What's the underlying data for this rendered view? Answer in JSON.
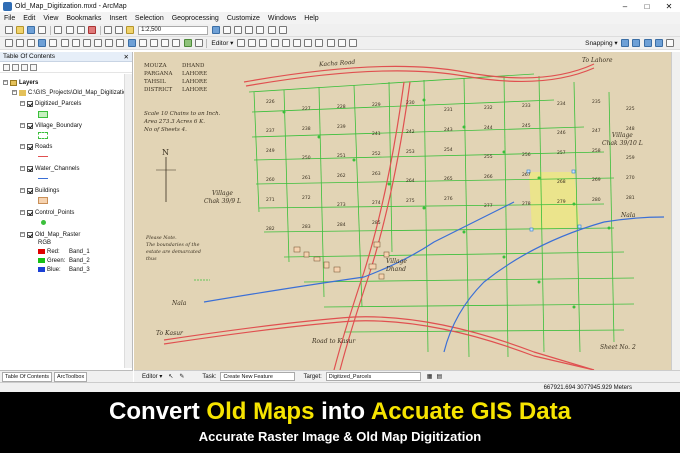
{
  "window": {
    "title": "Old_Map_Digitization.mxd - ArcMap",
    "minimize": "–",
    "maximize": "□",
    "close": "✕"
  },
  "menu": [
    "File",
    "Edit",
    "View",
    "Bookmarks",
    "Insert",
    "Selection",
    "Geoprocessing",
    "Customize",
    "Windows",
    "Help"
  ],
  "toolbar": {
    "scale": "1:2,500",
    "editor_label": "Editor ▾",
    "snapping_label": "Snapping ▾"
  },
  "toc": {
    "header": "Table Of Contents",
    "root": "Layers",
    "path": "C:\\GIS_Projects\\Old_Map_Digitization",
    "layers": [
      "Digitized_Parcels",
      "Village_Boundary",
      "Roads",
      "Water_Channels",
      "Buildings",
      "Control_Points",
      "Old_Map_Raster"
    ],
    "rgb_label": "RGB",
    "bands": [
      {
        "name": "Red:",
        "value": "Band_1",
        "color": "#e00000"
      },
      {
        "name": "Green:",
        "value": "Band_2",
        "color": "#16c016"
      },
      {
        "name": "Blue:",
        "value": "Band_3",
        "color": "#1a3fd6"
      }
    ]
  },
  "bottom_tabs": [
    "Table Of Contents",
    "ArcToolbox"
  ],
  "editor_bar": {
    "editor": "Editor ▾",
    "task_label": "Task:",
    "task_value": "Create New Feature",
    "target_label": "Target:",
    "target_value": "Digitized_Parcels"
  },
  "status": {
    "coords": "667921.694   3077945.929 Meters"
  },
  "map": {
    "info": [
      [
        "MOUZA",
        "DHAND"
      ],
      [
        "PARGANA",
        "LAHORE"
      ],
      [
        "TAHSIL",
        "LAHORE"
      ],
      [
        "DISTRICT",
        "LAHORE"
      ]
    ],
    "scale_note": [
      "Scale 10 Chains to an Inch.",
      "Area 273.3 Acres 6 K.",
      "No of Sheets 4."
    ],
    "north": "N",
    "kacha_road": "Kacha Road",
    "to_lahore": "To Lahore",
    "village_left": [
      "Village",
      "Chak 39/9 L"
    ],
    "village_right": [
      "Village",
      "Chak 39/10 L"
    ],
    "village_dhand": [
      "Village",
      "Dhand"
    ],
    "nala_right": "Nala",
    "nala_left": "Nala",
    "to_kasur": "To Kasur",
    "road_to_kasur": "Road to Kasur",
    "sheet": "Sheet No. 2",
    "note": [
      "Please Note.",
      "The boundaries of the",
      "estate are demarcated",
      "thus"
    ],
    "parcels": [
      "226",
      "227",
      "228",
      "229",
      "230",
      "231",
      "232",
      "233",
      "234",
      "235",
      "225",
      "237",
      "238",
      "239",
      "241",
      "242",
      "243",
      "244",
      "245",
      "246",
      "247",
      "248",
      "249",
      "250",
      "251",
      "252",
      "253",
      "254",
      "255",
      "256",
      "257",
      "258",
      "259",
      "260",
      "261",
      "262",
      "263",
      "264",
      "265",
      "266",
      "267",
      "268",
      "269",
      "270",
      "271",
      "272",
      "273",
      "274",
      "275",
      "276",
      "277",
      "278",
      "279",
      "280",
      "281",
      "282",
      "283",
      "284",
      "285"
    ]
  },
  "banner": {
    "line1": [
      "Convert ",
      "Old Maps",
      " into ",
      "Accuate GIS Data"
    ],
    "line2": "Accurate Raster Image & Old Map Digitization"
  },
  "colors": {
    "parcel_line": "#3bbf3b",
    "road": "#e05050",
    "water": "#3b6fd6",
    "selected_parcel": "#f3f06a",
    "map_paper": "#e9dcc0"
  }
}
